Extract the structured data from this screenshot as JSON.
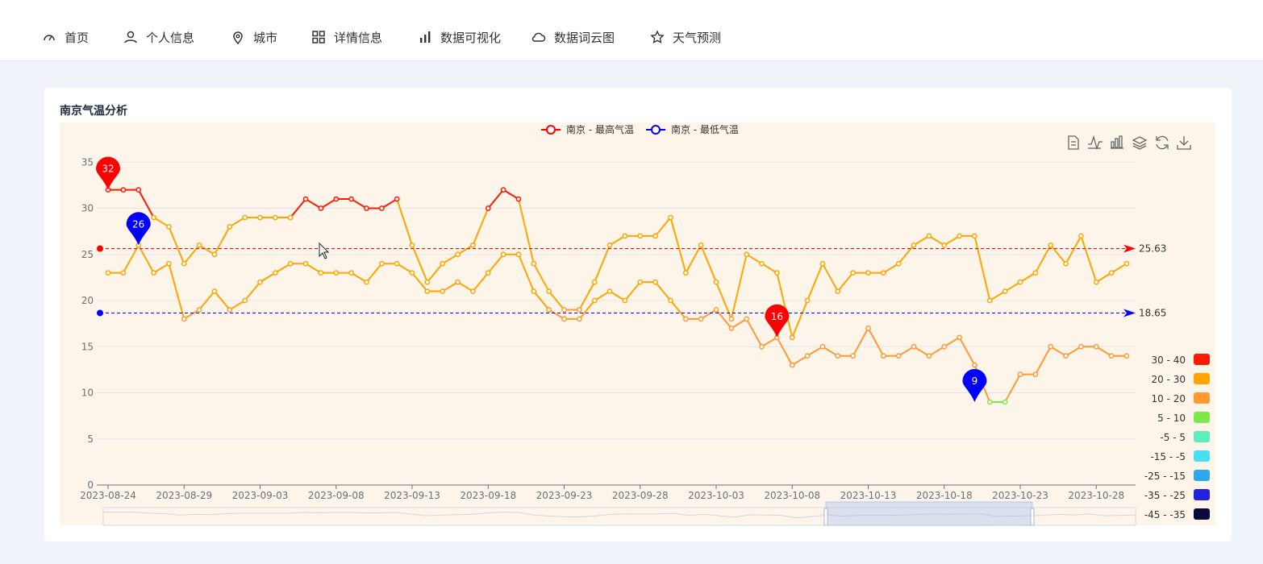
{
  "nav": {
    "items": [
      {
        "label": "首页",
        "icon": "gauge-icon"
      },
      {
        "label": "个人信息",
        "icon": "user-icon"
      },
      {
        "label": "城市",
        "icon": "location-pin-icon"
      },
      {
        "label": "详情信息",
        "icon": "grid-icon"
      },
      {
        "label": "数据可视化",
        "icon": "bar-chart-icon"
      },
      {
        "label": "数据词云图",
        "icon": "cloud-icon"
      },
      {
        "label": "天气预测",
        "icon": "star-icon"
      }
    ]
  },
  "card": {
    "title": "南京气温分析"
  },
  "toolbox": [
    "data-view-icon",
    "line-switch-icon",
    "bar-switch-icon",
    "stack-icon",
    "restore-icon",
    "save-image-icon"
  ],
  "chart_data": {
    "type": "line",
    "x": [
      "2023-08-24",
      "2023-08-25",
      "2023-08-26",
      "2023-08-27",
      "2023-08-28",
      "2023-08-29",
      "2023-08-30",
      "2023-08-31",
      "2023-09-01",
      "2023-09-02",
      "2023-09-03",
      "2023-09-04",
      "2023-09-05",
      "2023-09-06",
      "2023-09-07",
      "2023-09-08",
      "2023-09-09",
      "2023-09-10",
      "2023-09-11",
      "2023-09-12",
      "2023-09-13",
      "2023-09-14",
      "2023-09-15",
      "2023-09-16",
      "2023-09-17",
      "2023-09-18",
      "2023-09-19",
      "2023-09-20",
      "2023-09-21",
      "2023-09-22",
      "2023-09-23",
      "2023-09-24",
      "2023-09-25",
      "2023-09-26",
      "2023-09-27",
      "2023-09-28",
      "2023-09-29",
      "2023-09-30",
      "2023-10-01",
      "2023-10-02",
      "2023-10-03",
      "2023-10-04",
      "2023-10-05",
      "2023-10-06",
      "2023-10-07",
      "2023-10-08",
      "2023-10-09",
      "2023-10-10",
      "2023-10-11",
      "2023-10-12",
      "2023-10-13",
      "2023-10-14",
      "2023-10-15",
      "2023-10-16",
      "2023-10-17",
      "2023-10-18",
      "2023-10-19",
      "2023-10-20",
      "2023-10-21",
      "2023-10-22",
      "2023-10-23",
      "2023-10-24",
      "2023-10-25",
      "2023-10-26",
      "2023-10-27",
      "2023-10-28"
    ],
    "x_tick_labels": [
      "2023-08-24",
      "2023-08-29",
      "2023-09-03",
      "2023-09-08",
      "2023-09-13",
      "2023-09-18",
      "2023-09-23",
      "2023-09-28",
      "2023-10-03",
      "2023-10-08",
      "2023-10-13",
      "2023-10-18",
      "2023-10-23",
      "2023-10-28"
    ],
    "y_ticks": [
      "0",
      "5",
      "10",
      "15",
      "20",
      "25",
      "30",
      "35"
    ],
    "ylim": [
      0,
      35
    ],
    "series": [
      {
        "name": "南京 - 最高气温",
        "color": "#ff0000",
        "values": [
          32,
          32,
          32,
          29,
          28,
          24,
          26,
          25,
          28,
          29,
          29,
          29,
          29,
          31,
          30,
          31,
          31,
          30,
          30,
          31,
          26,
          22,
          24,
          25,
          26,
          30,
          32,
          31,
          24,
          21,
          19,
          19,
          22,
          26,
          27,
          27,
          27,
          29,
          23,
          26,
          22,
          18,
          25,
          24,
          23,
          16,
          20,
          24,
          21,
          23,
          23,
          23,
          24,
          26,
          27,
          26,
          27,
          27,
          20,
          21,
          22,
          23,
          26,
          24,
          27,
          22,
          23,
          24
        ]
      },
      {
        "name": "南京 - 最低气温",
        "color": "#0000ff",
        "values": [
          23,
          23,
          26,
          23,
          24,
          18,
          19,
          21,
          19,
          20,
          22,
          23,
          24,
          24,
          23,
          23,
          23,
          22,
          24,
          24,
          23,
          21,
          21,
          22,
          21,
          23,
          25,
          25,
          21,
          19,
          18,
          18,
          20,
          21,
          20,
          22,
          22,
          20,
          18,
          18,
          19,
          17,
          18,
          15,
          16,
          13,
          14,
          15,
          14,
          14,
          17,
          14,
          14,
          15,
          14,
          15,
          16,
          13,
          9,
          9,
          12,
          12,
          15,
          14,
          15,
          15,
          14,
          14
        ]
      }
    ],
    "markpoints": [
      {
        "series": 0,
        "type": "max",
        "label": "32",
        "x": "2023-08-24",
        "value": 32
      },
      {
        "series": 0,
        "type": "min",
        "label": "16",
        "x": "2023-10-07",
        "value": 16
      },
      {
        "series": 1,
        "type": "max",
        "label": "26",
        "x": "2023-08-26",
        "value": 26
      },
      {
        "series": 1,
        "type": "min",
        "label": "9",
        "x": "2023-10-20",
        "value": 9
      }
    ],
    "marklines": [
      {
        "series": 0,
        "type": "average",
        "label": "25.63",
        "value": 25.63
      },
      {
        "series": 1,
        "type": "average",
        "label": "18.65",
        "value": 18.65
      }
    ],
    "visual_map": [
      {
        "label": "30 - 40",
        "min": 30,
        "max": 40,
        "color": "#ff1a00"
      },
      {
        "label": "20 - 30",
        "min": 20,
        "max": 30,
        "color": "#ffa500"
      },
      {
        "label": "10 - 20",
        "min": 10,
        "max": 20,
        "color": "#ff9933"
      },
      {
        "label": "5 - 10",
        "min": 5,
        "max": 10,
        "color": "#7ee84a"
      },
      {
        "label": "-5 - 5",
        "min": -5,
        "max": 5,
        "color": "#5eeebb"
      },
      {
        "label": "-15 - -5",
        "min": -15,
        "max": -5,
        "color": "#49dff0"
      },
      {
        "label": "-25 - -15",
        "min": -25,
        "max": -15,
        "color": "#2fa7ea"
      },
      {
        "label": "-35 - -25",
        "min": -35,
        "max": -25,
        "color": "#2222dd"
      },
      {
        "label": "-45 - -35",
        "min": -45,
        "max": -35,
        "color": "#0a0a3a"
      }
    ],
    "datazoom": {
      "start_fraction": 0.7,
      "end_fraction": 0.9
    },
    "grid": true,
    "legend_position": "top-center"
  }
}
